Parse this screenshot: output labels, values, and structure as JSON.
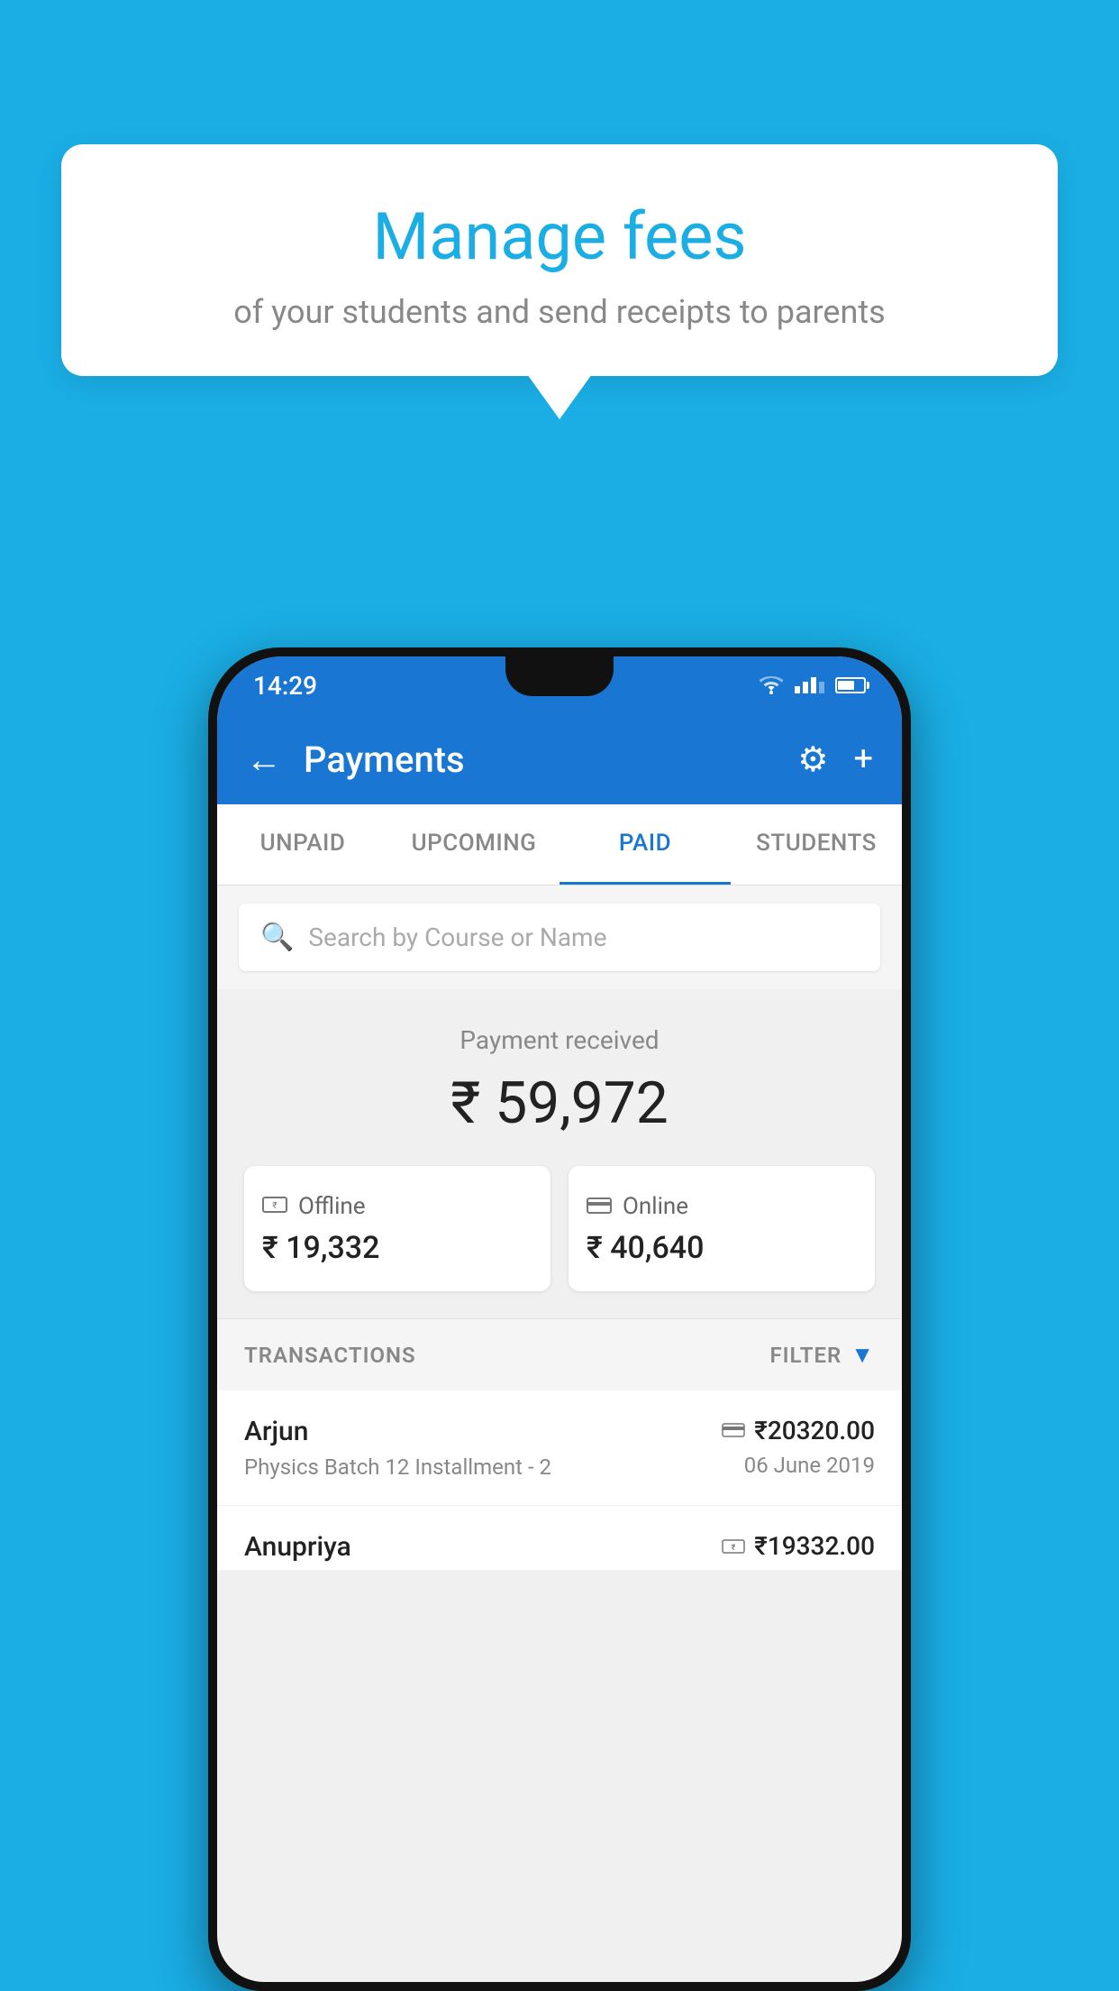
{
  "page": {
    "background_color": "#1aaee5"
  },
  "bubble": {
    "title": "Manage fees",
    "subtitle": "of your students and send receipts to parents"
  },
  "status_bar": {
    "time": "14:29"
  },
  "app_bar": {
    "title": "Payments",
    "back_label": "←",
    "gear_label": "⚙",
    "plus_label": "+"
  },
  "tabs": [
    {
      "label": "UNPAID",
      "active": false
    },
    {
      "label": "UPCOMING",
      "active": false
    },
    {
      "label": "PAID",
      "active": true
    },
    {
      "label": "STUDENTS",
      "active": false
    }
  ],
  "search": {
    "placeholder": "Search by Course or Name"
  },
  "payment_summary": {
    "label": "Payment received",
    "total": "₹ 59,972",
    "offline_label": "Offline",
    "offline_amount": "₹ 19,332",
    "online_label": "Online",
    "online_amount": "₹ 40,640"
  },
  "transactions": {
    "section_label": "TRANSACTIONS",
    "filter_label": "FILTER",
    "rows": [
      {
        "name": "Arjun",
        "detail": "Physics Batch 12 Installment - 2",
        "amount": "₹20320.00",
        "date": "06 June 2019",
        "payment_type": "online"
      },
      {
        "name": "Anupriya",
        "detail": "",
        "amount": "₹19332.00",
        "date": "",
        "payment_type": "offline"
      }
    ]
  }
}
